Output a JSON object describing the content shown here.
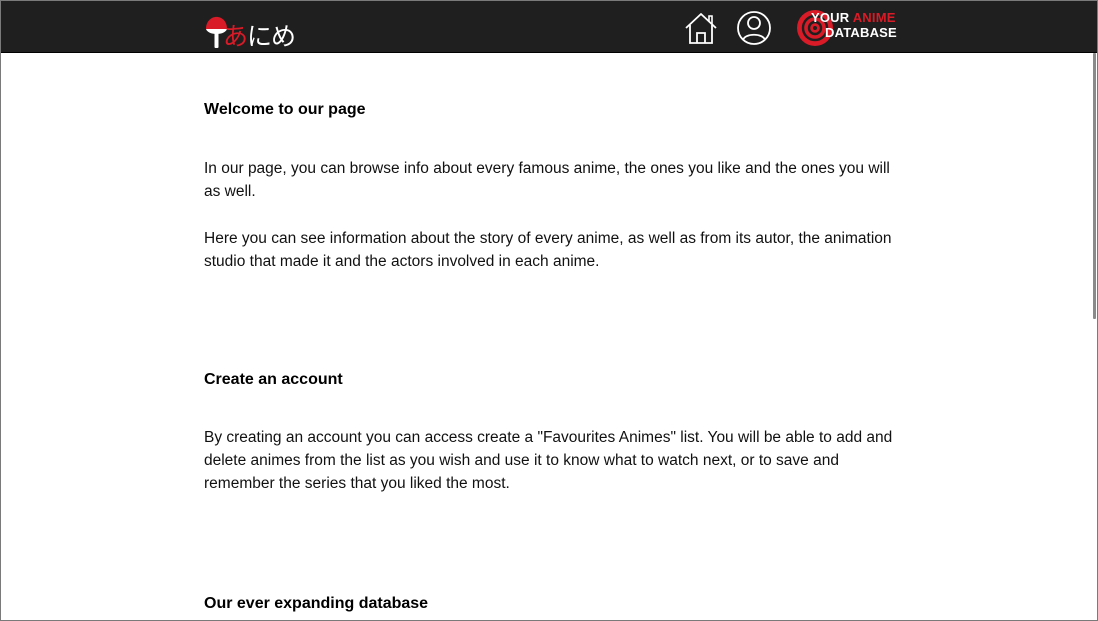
{
  "header": {
    "logo_kana": "にめ",
    "logo_kana_red": "あ",
    "home_icon": "home-icon",
    "user_icon": "user-circle-icon",
    "badge": {
      "line1_white": "YOUR",
      "line1_red": "ANIME",
      "line2": "DATABASE"
    }
  },
  "main": {
    "welcome_title": "Welcome to our page",
    "welcome_p1": "In our page, you can browse info about every famous anime, the ones you like and the ones you will as well.",
    "welcome_p2": "Here you can see information about the story of every anime, as well as from its autor, the animation studio that made it and the actors involved in each anime.",
    "account_title": "Create an account",
    "account_p1": "By creating an account you can access create a \"Favourites Animes\" list. You will be able to add and delete animes from the list as you wish and use it to know what to watch next, or to save and remember the series that you liked the most.",
    "database_title": "Our ever expanding database"
  },
  "colors": {
    "bar": "#1f1f1f",
    "accent_red": "#d81b27"
  }
}
